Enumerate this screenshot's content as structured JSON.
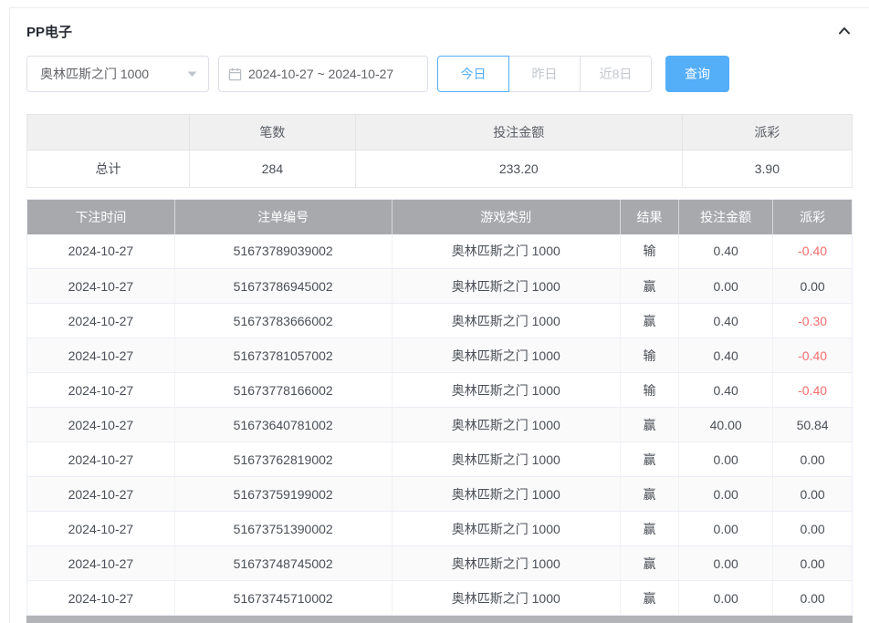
{
  "header": {
    "title": "PP电子"
  },
  "filters": {
    "game_select": {
      "value": "奥林匹斯之门 1000"
    },
    "date_range": {
      "value": "2024-10-27 ~ 2024-10-27"
    },
    "quick_buttons": [
      {
        "id": "today",
        "label": "今日",
        "active": true
      },
      {
        "id": "yesterday",
        "label": "昨日",
        "active": false
      },
      {
        "id": "last-8-days",
        "label": "近8日",
        "active": false
      }
    ],
    "search_button_label": "查询"
  },
  "summary_table": {
    "headers": [
      "",
      "笔数",
      "投注金额",
      "派彩"
    ],
    "total_row": {
      "label": "总计",
      "count": "284",
      "bet_amount": "233.20",
      "payout": "3.90"
    }
  },
  "records_table": {
    "headers": [
      "下注时间",
      "注单编号",
      "游戏类别",
      "结果",
      "投注金额",
      "派彩"
    ],
    "rows": [
      {
        "bet_time": "2024-10-27",
        "order_id": "51673789039002",
        "game": "奥林匹斯之门 1000",
        "result": "输",
        "bet_amount": "0.40",
        "payout": "-0.40"
      },
      {
        "bet_time": "2024-10-27",
        "order_id": "51673786945002",
        "game": "奥林匹斯之门 1000",
        "result": "赢",
        "bet_amount": "0.00",
        "payout": "0.00"
      },
      {
        "bet_time": "2024-10-27",
        "order_id": "51673783666002",
        "game": "奥林匹斯之门 1000",
        "result": "赢",
        "bet_amount": "0.40",
        "payout": "-0.30"
      },
      {
        "bet_time": "2024-10-27",
        "order_id": "51673781057002",
        "game": "奥林匹斯之门 1000",
        "result": "输",
        "bet_amount": "0.40",
        "payout": "-0.40"
      },
      {
        "bet_time": "2024-10-27",
        "order_id": "51673778166002",
        "game": "奥林匹斯之门 1000",
        "result": "输",
        "bet_amount": "0.40",
        "payout": "-0.40"
      },
      {
        "bet_time": "2024-10-27",
        "order_id": "51673640781002",
        "game": "奥林匹斯之门 1000",
        "result": "赢",
        "bet_amount": "40.00",
        "payout": "50.84"
      },
      {
        "bet_time": "2024-10-27",
        "order_id": "51673762819002",
        "game": "奥林匹斯之门 1000",
        "result": "赢",
        "bet_amount": "0.00",
        "payout": "0.00"
      },
      {
        "bet_time": "2024-10-27",
        "order_id": "51673759199002",
        "game": "奥林匹斯之门 1000",
        "result": "赢",
        "bet_amount": "0.00",
        "payout": "0.00"
      },
      {
        "bet_time": "2024-10-27",
        "order_id": "51673751390002",
        "game": "奥林匹斯之门 1000",
        "result": "赢",
        "bet_amount": "0.00",
        "payout": "0.00"
      },
      {
        "bet_time": "2024-10-27",
        "order_id": "51673748745002",
        "game": "奥林匹斯之门 1000",
        "result": "赢",
        "bet_amount": "0.00",
        "payout": "0.00"
      },
      {
        "bet_time": "2024-10-27",
        "order_id": "51673745710002",
        "game": "奥林匹斯之门 1000",
        "result": "赢",
        "bet_amount": "0.00",
        "payout": "0.00"
      }
    ]
  },
  "colors": {
    "accent": "#54aef8",
    "negative": "#f56c6c",
    "table_header_bg": "#a7a9ac",
    "summary_header_bg": "#f0f0f0"
  }
}
